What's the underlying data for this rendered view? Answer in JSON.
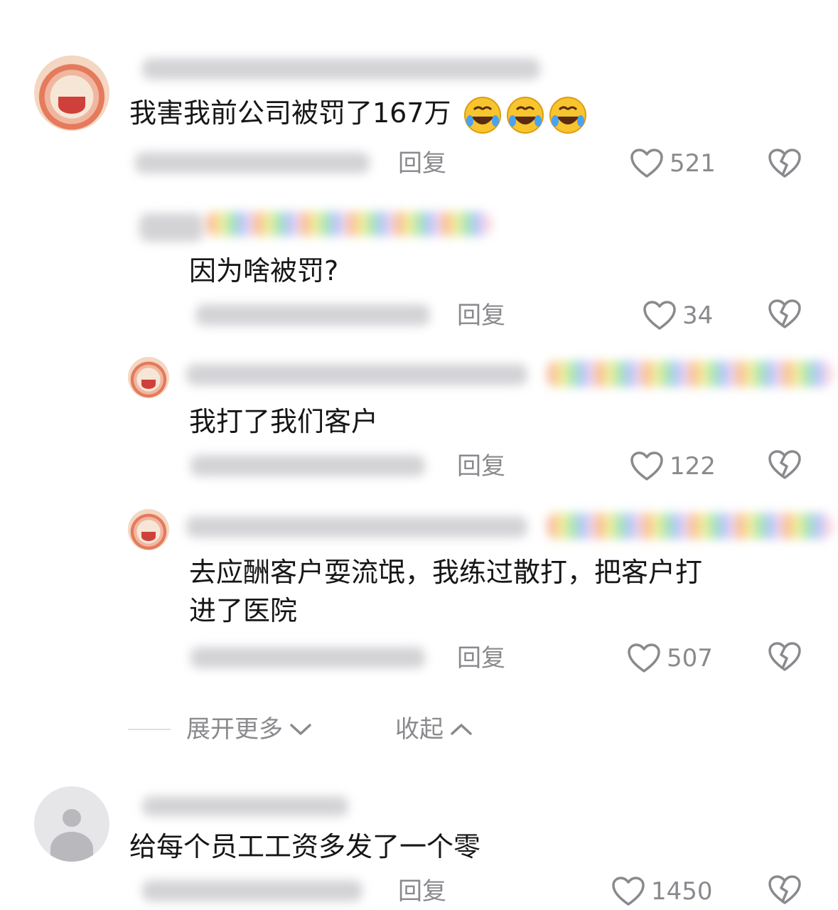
{
  "comments": [
    {
      "text": "我害我前公司被罚了167万",
      "emoji": "rofl-emoji",
      "reply_label": "回复",
      "likes": "521"
    },
    {
      "text": "因为啥被罚?",
      "reply_label": "回复",
      "likes": "34"
    },
    {
      "text": "我打了我们客户",
      "reply_label": "回复",
      "likes": "122"
    },
    {
      "text_line1": "去应酬客户耍流氓，我练过散打，把客户打",
      "text_line2": "进了医院",
      "reply_label": "回复",
      "likes": "507"
    },
    {
      "text": "给每个员工工资多发了一个零",
      "reply_label": "回复",
      "likes": "1450"
    }
  ],
  "thread_controls": {
    "expand_label": "展开更多",
    "collapse_label": "收起"
  },
  "colors": {
    "text": "#161616",
    "meta": "#8a8a8e",
    "background": "#ffffff"
  }
}
